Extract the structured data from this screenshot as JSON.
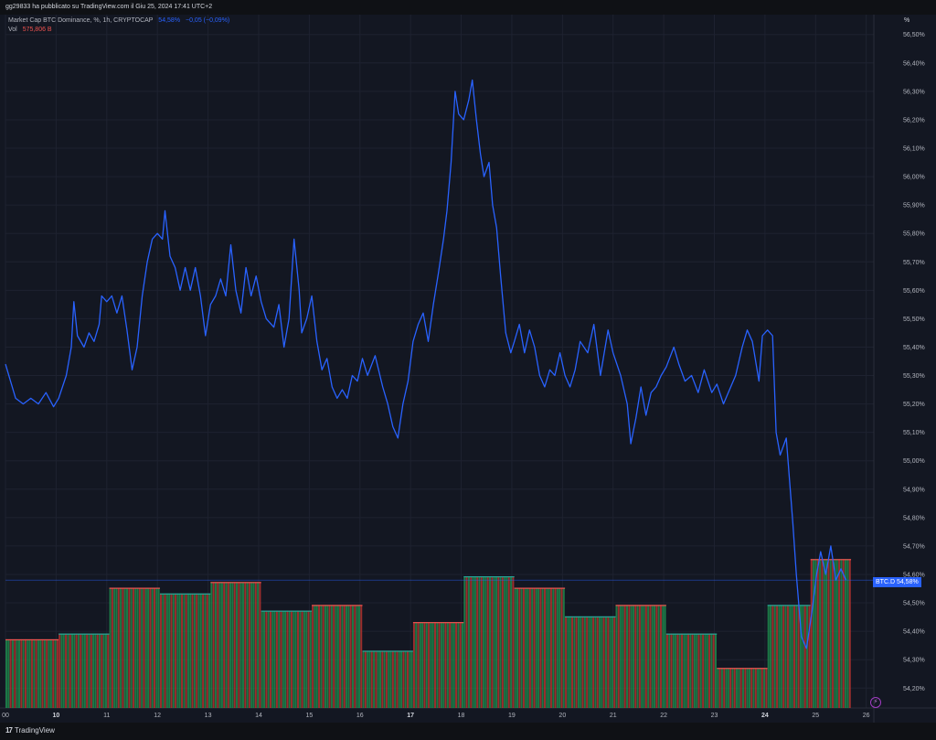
{
  "header": {
    "published_text": "gg29833 ha pubblicato su TradingView.com il Giu 25, 2024 17:41 UTC+2"
  },
  "legend": {
    "title": "Market Cap BTC Dominance, %, 1h, CRYPTOCAP",
    "value": "54,58%",
    "change": "−0,05 (−0,09%)",
    "volume_label": "Vol",
    "volume_value": "575,806 B"
  },
  "price_axis": {
    "unit": "%",
    "badge_label": "BTC.D",
    "badge_value": "54,58%"
  },
  "branding": {
    "logo_text": "TradingView",
    "logo_icon": "tradingview-logo-icon",
    "bolt_icon": "lightning-bolt-icon"
  },
  "colors": {
    "background": "#131722",
    "line": "#2962ff",
    "volume_up": "#26a69a",
    "volume_down": "#ef5350",
    "grid": "#1e2230"
  },
  "chart_data": {
    "type": "line",
    "title": "Market Cap BTC Dominance, %, 1h, CRYPTOCAP",
    "xlabel": "",
    "ylabel": "",
    "ylim": [
      54.13,
      56.57
    ],
    "y_ticks": [
      "56,50%",
      "56,40%",
      "56,30%",
      "56,20%",
      "56,10%",
      "56,00%",
      "55,90%",
      "55,80%",
      "55,70%",
      "55,60%",
      "55,50%",
      "55,40%",
      "55,30%",
      "55,20%",
      "55,10%",
      "55,00%",
      "54,90%",
      "54,80%",
      "54,70%",
      "54,60%",
      "54,50%",
      "54,40%",
      "54,30%",
      "54,20%"
    ],
    "x_range": [
      9.0,
      26.15
    ],
    "x_ticks": [
      {
        "x": 9,
        "label": "00",
        "bold": false
      },
      {
        "x": 10,
        "label": "10",
        "bold": true
      },
      {
        "x": 11,
        "label": "11",
        "bold": false
      },
      {
        "x": 12,
        "label": "12",
        "bold": false
      },
      {
        "x": 13,
        "label": "13",
        "bold": false
      },
      {
        "x": 14,
        "label": "14",
        "bold": false
      },
      {
        "x": 15,
        "label": "15",
        "bold": false
      },
      {
        "x": 16,
        "label": "16",
        "bold": false
      },
      {
        "x": 17,
        "label": "17",
        "bold": true
      },
      {
        "x": 18,
        "label": "18",
        "bold": false
      },
      {
        "x": 19,
        "label": "19",
        "bold": false
      },
      {
        "x": 20,
        "label": "20",
        "bold": false
      },
      {
        "x": 21,
        "label": "21",
        "bold": false
      },
      {
        "x": 22,
        "label": "22",
        "bold": false
      },
      {
        "x": 23,
        "label": "23",
        "bold": false
      },
      {
        "x": 24,
        "label": "24",
        "bold": true
      },
      {
        "x": 25,
        "label": "25",
        "bold": false
      },
      {
        "x": 26,
        "label": "26",
        "bold": false
      }
    ],
    "series": [
      {
        "points": [
          [
            9.0,
            55.34
          ],
          [
            9.1,
            55.28
          ],
          [
            9.2,
            55.22
          ],
          [
            9.35,
            55.2
          ],
          [
            9.5,
            55.22
          ],
          [
            9.65,
            55.2
          ],
          [
            9.8,
            55.24
          ],
          [
            9.95,
            55.19
          ],
          [
            10.05,
            55.22
          ],
          [
            10.2,
            55.3
          ],
          [
            10.3,
            55.4
          ],
          [
            10.35,
            55.56
          ],
          [
            10.42,
            55.44
          ],
          [
            10.55,
            55.4
          ],
          [
            10.65,
            55.45
          ],
          [
            10.75,
            55.42
          ],
          [
            10.85,
            55.48
          ],
          [
            10.9,
            55.58
          ],
          [
            11.0,
            55.56
          ],
          [
            11.1,
            55.58
          ],
          [
            11.2,
            55.52
          ],
          [
            11.3,
            55.58
          ],
          [
            11.4,
            55.46
          ],
          [
            11.5,
            55.32
          ],
          [
            11.6,
            55.4
          ],
          [
            11.7,
            55.58
          ],
          [
            11.8,
            55.7
          ],
          [
            11.9,
            55.78
          ],
          [
            12.0,
            55.8
          ],
          [
            12.1,
            55.78
          ],
          [
            12.15,
            55.88
          ],
          [
            12.25,
            55.72
          ],
          [
            12.35,
            55.68
          ],
          [
            12.45,
            55.6
          ],
          [
            12.55,
            55.68
          ],
          [
            12.65,
            55.6
          ],
          [
            12.75,
            55.68
          ],
          [
            12.85,
            55.58
          ],
          [
            12.95,
            55.44
          ],
          [
            13.05,
            55.55
          ],
          [
            13.15,
            55.58
          ],
          [
            13.25,
            55.64
          ],
          [
            13.35,
            55.58
          ],
          [
            13.45,
            55.76
          ],
          [
            13.55,
            55.6
          ],
          [
            13.65,
            55.52
          ],
          [
            13.75,
            55.68
          ],
          [
            13.85,
            55.58
          ],
          [
            13.95,
            55.65
          ],
          [
            14.05,
            55.56
          ],
          [
            14.15,
            55.5
          ],
          [
            14.3,
            55.47
          ],
          [
            14.4,
            55.55
          ],
          [
            14.5,
            55.4
          ],
          [
            14.6,
            55.5
          ],
          [
            14.7,
            55.78
          ],
          [
            14.8,
            55.6
          ],
          [
            14.85,
            55.45
          ],
          [
            14.95,
            55.5
          ],
          [
            15.05,
            55.58
          ],
          [
            15.15,
            55.42
          ],
          [
            15.25,
            55.32
          ],
          [
            15.35,
            55.36
          ],
          [
            15.45,
            55.26
          ],
          [
            15.55,
            55.22
          ],
          [
            15.65,
            55.25
          ],
          [
            15.75,
            55.22
          ],
          [
            15.85,
            55.3
          ],
          [
            15.95,
            55.28
          ],
          [
            16.05,
            55.36
          ],
          [
            16.15,
            55.3
          ],
          [
            16.3,
            55.37
          ],
          [
            16.45,
            55.26
          ],
          [
            16.55,
            55.2
          ],
          [
            16.65,
            55.12
          ],
          [
            16.75,
            55.08
          ],
          [
            16.85,
            55.2
          ],
          [
            16.95,
            55.28
          ],
          [
            17.05,
            55.42
          ],
          [
            17.15,
            55.48
          ],
          [
            17.25,
            55.52
          ],
          [
            17.35,
            55.42
          ],
          [
            17.45,
            55.55
          ],
          [
            17.55,
            55.66
          ],
          [
            17.65,
            55.78
          ],
          [
            17.72,
            55.88
          ],
          [
            17.8,
            56.05
          ],
          [
            17.88,
            56.3
          ],
          [
            17.95,
            56.22
          ],
          [
            18.05,
            56.2
          ],
          [
            18.15,
            56.27
          ],
          [
            18.22,
            56.34
          ],
          [
            18.3,
            56.2
          ],
          [
            18.38,
            56.08
          ],
          [
            18.45,
            56.0
          ],
          [
            18.55,
            56.05
          ],
          [
            18.62,
            55.9
          ],
          [
            18.7,
            55.82
          ],
          [
            18.78,
            55.65
          ],
          [
            18.88,
            55.45
          ],
          [
            18.98,
            55.38
          ],
          [
            19.05,
            55.42
          ],
          [
            19.15,
            55.48
          ],
          [
            19.25,
            55.38
          ],
          [
            19.35,
            55.46
          ],
          [
            19.45,
            55.4
          ],
          [
            19.55,
            55.3
          ],
          [
            19.65,
            55.26
          ],
          [
            19.75,
            55.32
          ],
          [
            19.85,
            55.3
          ],
          [
            19.95,
            55.38
          ],
          [
            20.05,
            55.3
          ],
          [
            20.15,
            55.26
          ],
          [
            20.25,
            55.32
          ],
          [
            20.35,
            55.42
          ],
          [
            20.5,
            55.38
          ],
          [
            20.62,
            55.48
          ],
          [
            20.75,
            55.3
          ],
          [
            20.9,
            55.46
          ],
          [
            21.0,
            55.38
          ],
          [
            21.15,
            55.3
          ],
          [
            21.28,
            55.2
          ],
          [
            21.35,
            55.06
          ],
          [
            21.45,
            55.15
          ],
          [
            21.55,
            55.26
          ],
          [
            21.65,
            55.16
          ],
          [
            21.75,
            55.24
          ],
          [
            21.85,
            55.26
          ],
          [
            21.95,
            55.3
          ],
          [
            22.05,
            55.33
          ],
          [
            22.2,
            55.4
          ],
          [
            22.3,
            55.34
          ],
          [
            22.42,
            55.28
          ],
          [
            22.55,
            55.3
          ],
          [
            22.68,
            55.24
          ],
          [
            22.8,
            55.32
          ],
          [
            22.95,
            55.24
          ],
          [
            23.05,
            55.27
          ],
          [
            23.18,
            55.2
          ],
          [
            23.3,
            55.25
          ],
          [
            23.42,
            55.3
          ],
          [
            23.55,
            55.4
          ],
          [
            23.65,
            55.46
          ],
          [
            23.75,
            55.42
          ],
          [
            23.88,
            55.28
          ],
          [
            23.95,
            55.44
          ],
          [
            24.05,
            55.46
          ],
          [
            24.15,
            55.44
          ],
          [
            24.22,
            55.1
          ],
          [
            24.3,
            55.02
          ],
          [
            24.42,
            55.08
          ],
          [
            24.55,
            54.78
          ],
          [
            24.62,
            54.6
          ],
          [
            24.72,
            54.38
          ],
          [
            24.82,
            54.34
          ],
          [
            24.92,
            54.46
          ],
          [
            25.02,
            54.6
          ],
          [
            25.1,
            54.68
          ],
          [
            25.2,
            54.6
          ],
          [
            25.3,
            54.7
          ],
          [
            25.4,
            54.58
          ],
          [
            25.5,
            54.62
          ],
          [
            25.6,
            54.58
          ]
        ]
      }
    ],
    "volume": {
      "periods": [
        {
          "x0": 9.0,
          "x1": 10.05,
          "level": 0.12
        },
        {
          "x0": 10.05,
          "x1": 11.05,
          "level": 0.13
        },
        {
          "x0": 11.05,
          "x1": 12.05,
          "level": 0.21
        },
        {
          "x0": 12.05,
          "x1": 13.05,
          "level": 0.2
        },
        {
          "x0": 13.05,
          "x1": 14.05,
          "level": 0.22
        },
        {
          "x0": 14.05,
          "x1": 15.05,
          "level": 0.17
        },
        {
          "x0": 15.05,
          "x1": 16.05,
          "level": 0.18
        },
        {
          "x0": 16.05,
          "x1": 17.05,
          "level": 0.1
        },
        {
          "x0": 17.05,
          "x1": 18.05,
          "level": 0.15
        },
        {
          "x0": 18.05,
          "x1": 19.05,
          "level": 0.23
        },
        {
          "x0": 19.05,
          "x1": 20.05,
          "level": 0.21
        },
        {
          "x0": 20.05,
          "x1": 21.05,
          "level": 0.16
        },
        {
          "x0": 21.05,
          "x1": 22.05,
          "level": 0.18
        },
        {
          "x0": 22.05,
          "x1": 23.05,
          "level": 0.13
        },
        {
          "x0": 23.05,
          "x1": 24.05,
          "level": 0.07
        },
        {
          "x0": 24.05,
          "x1": 24.9,
          "level": 0.18
        },
        {
          "x0": 24.9,
          "x1": 25.7,
          "level": 0.26
        }
      ]
    },
    "current_value": 54.58,
    "grid": true,
    "legend": "top-left"
  }
}
